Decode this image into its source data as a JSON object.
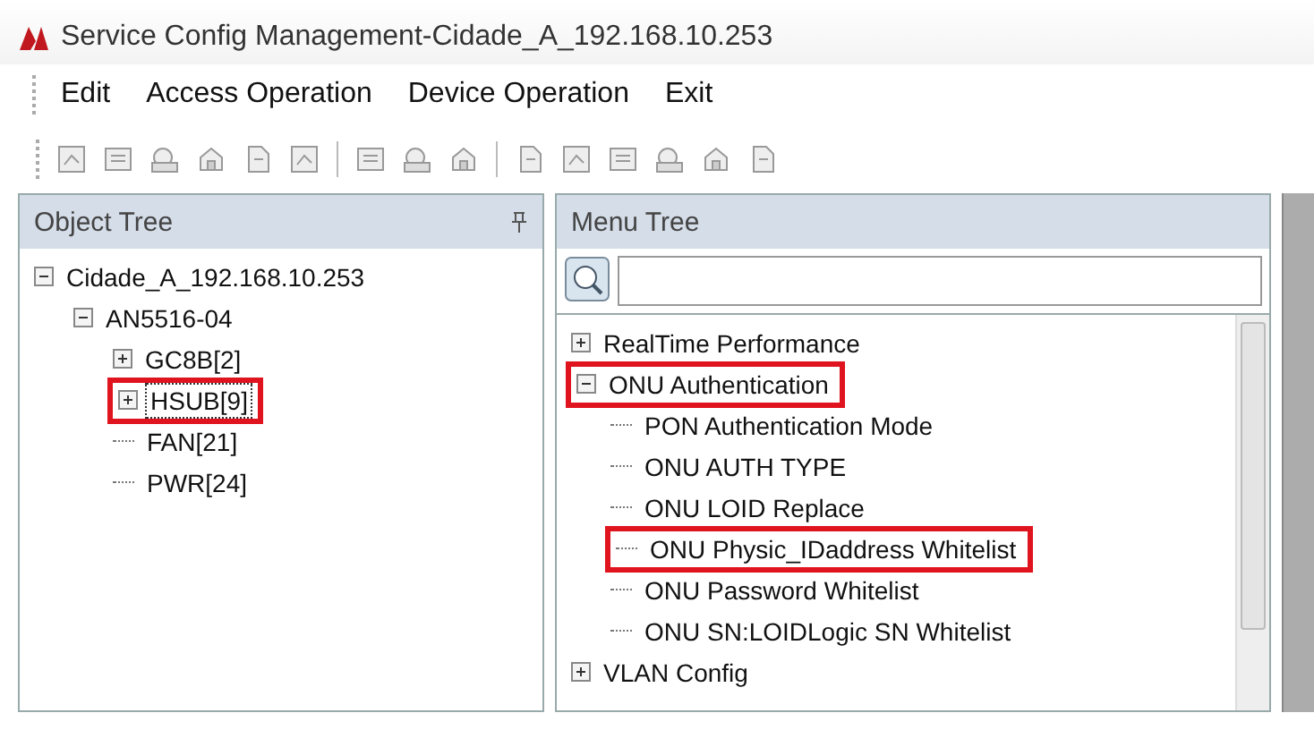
{
  "window": {
    "title": "Service Config Management-Cidade_A_192.168.10.253"
  },
  "menu_bar": [
    "Edit",
    "Access Operation",
    "Device Operation",
    "Exit"
  ],
  "object_tree": {
    "title": "Object Tree",
    "items": [
      {
        "label": "Cidade_A_192.168.10.253",
        "expanded": true,
        "selected": false,
        "highlighted": false,
        "children": [
          {
            "label": "AN5516-04",
            "expanded": true,
            "selected": false,
            "highlighted": false,
            "children": [
              {
                "label": "GC8B[2]",
                "expanded": false,
                "selected": false,
                "highlighted": false
              },
              {
                "label": "HSUB[9]",
                "expanded": false,
                "selected": true,
                "highlighted": true
              },
              {
                "label": "FAN[21]",
                "selected": false,
                "highlighted": false
              },
              {
                "label": "PWR[24]",
                "selected": false,
                "highlighted": false
              }
            ]
          }
        ]
      }
    ]
  },
  "menu_tree": {
    "title": "Menu Tree",
    "items": [
      {
        "label": "RealTime Performance",
        "expanded": false,
        "selected": false,
        "highlighted": false
      },
      {
        "label": "ONU Authentication",
        "expanded": true,
        "selected": false,
        "highlighted": true,
        "children": [
          {
            "label": "PON Authentication Mode",
            "selected": false,
            "highlighted": false
          },
          {
            "label": "ONU AUTH TYPE",
            "selected": false,
            "highlighted": false
          },
          {
            "label": "ONU LOID Replace",
            "selected": false,
            "highlighted": false
          },
          {
            "label": "ONU Physic_IDaddress Whitelist",
            "selected": false,
            "highlighted": true
          },
          {
            "label": "ONU Password Whitelist",
            "selected": false,
            "highlighted": false
          },
          {
            "label": "ONU SN:LOIDLogic SN Whitelist",
            "selected": false,
            "highlighted": false
          }
        ]
      },
      {
        "label": "VLAN Config",
        "expanded": false,
        "selected": false,
        "highlighted": false
      }
    ]
  }
}
